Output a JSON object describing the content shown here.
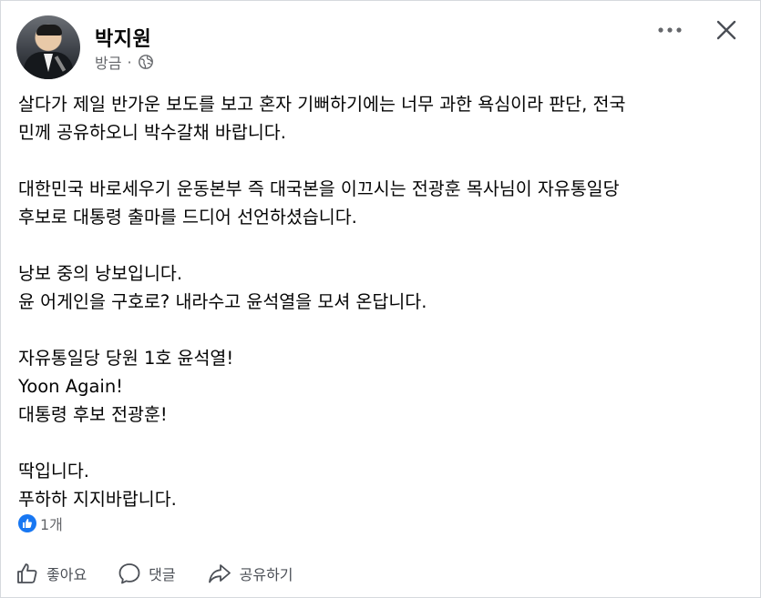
{
  "post": {
    "author": "박지원",
    "time": "방금",
    "separator": "·",
    "paragraphs": [
      [
        "살다가 제일 반가운 보도를 보고 혼자 기뻐하기에는 너무 과한 욕심이라 판단, 전국",
        "민께 공유하오니 박수갈채 바랍니다."
      ],
      [
        "대한민국 바로세우기 운동본부 즉 대국본을 이끄시는 전광훈 목사님이 자유통일당",
        "후보로 대통령 출마를 드디어 선언하셨습니다."
      ],
      [
        "낭보 중의 낭보입니다.",
        "윤 어게인을 구호로? 내라수고 윤석열을 모셔 온답니다."
      ],
      [
        "자유통일당 당원 1호 윤석열!",
        "Yoon Again!",
        "대통령 후보 전광훈!"
      ],
      [
        "딱입니다.",
        "푸하하 지지바랍니다."
      ]
    ],
    "reaction_count": "1개"
  },
  "actions": {
    "like_label": "좋아요",
    "comment_label": "댓글",
    "share_label": "공유하기"
  },
  "icons": {
    "privacy": "globe-icon",
    "more": "more-options-icon",
    "close": "close-icon",
    "reaction": "like-reaction-icon",
    "like": "thumbs-up-icon",
    "comment": "comment-bubble-icon",
    "share": "share-arrow-icon"
  },
  "colors": {
    "text": "#050505",
    "secondary": "#65676b",
    "like_blue": "#1877f2"
  }
}
